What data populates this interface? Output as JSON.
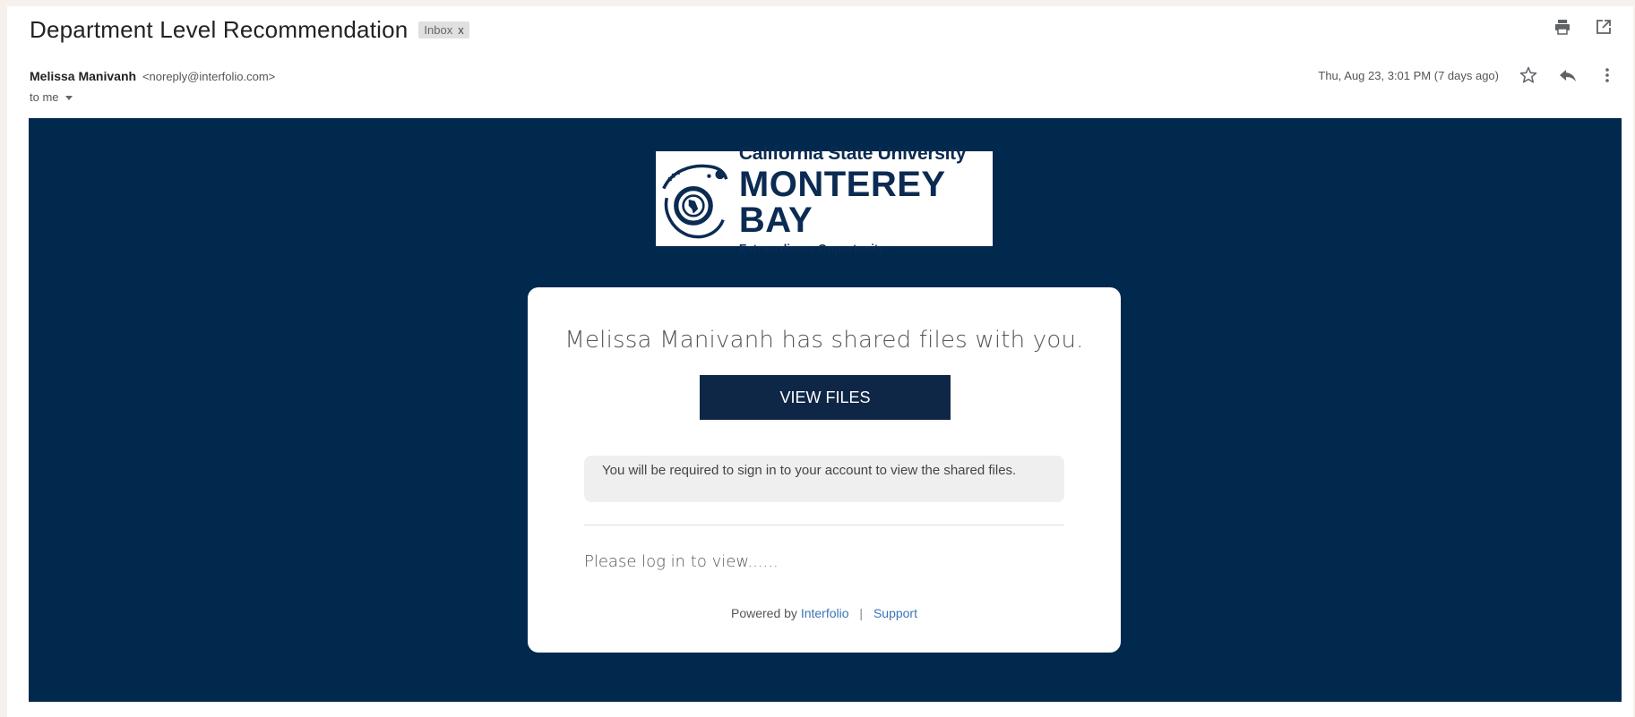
{
  "email": {
    "subject": "Department Level Recommendation",
    "label": "Inbox",
    "label_remove": "x",
    "sender_name": "Melissa Manivanh",
    "sender_email": "<noreply@interfolio.com>",
    "recipient": "to me",
    "date": "Thu, Aug 23, 3:01 PM (7 days ago)"
  },
  "toolbar_icons": [
    "print-icon",
    "open-in-new-window-icon",
    "star-icon",
    "reply-icon",
    "more-vert-icon"
  ],
  "logo": {
    "line1": "California State University",
    "line2": "MONTEREY BAY",
    "line3": "Extraordinary Opportunity"
  },
  "card": {
    "title": "Melissa Manivanh has shared files with you.",
    "button_label": "VIEW FILES",
    "note": "You will be required to sign in to your account to view the shared files.",
    "message": "Please log in to view......",
    "powered_by": "Powered by",
    "interfolio_link": "Interfolio",
    "separator": "|",
    "support_link": "Support"
  },
  "colors": {
    "banner_bg": "#00294d",
    "button_bg": "#0f2747",
    "link": "#3a74b6"
  }
}
